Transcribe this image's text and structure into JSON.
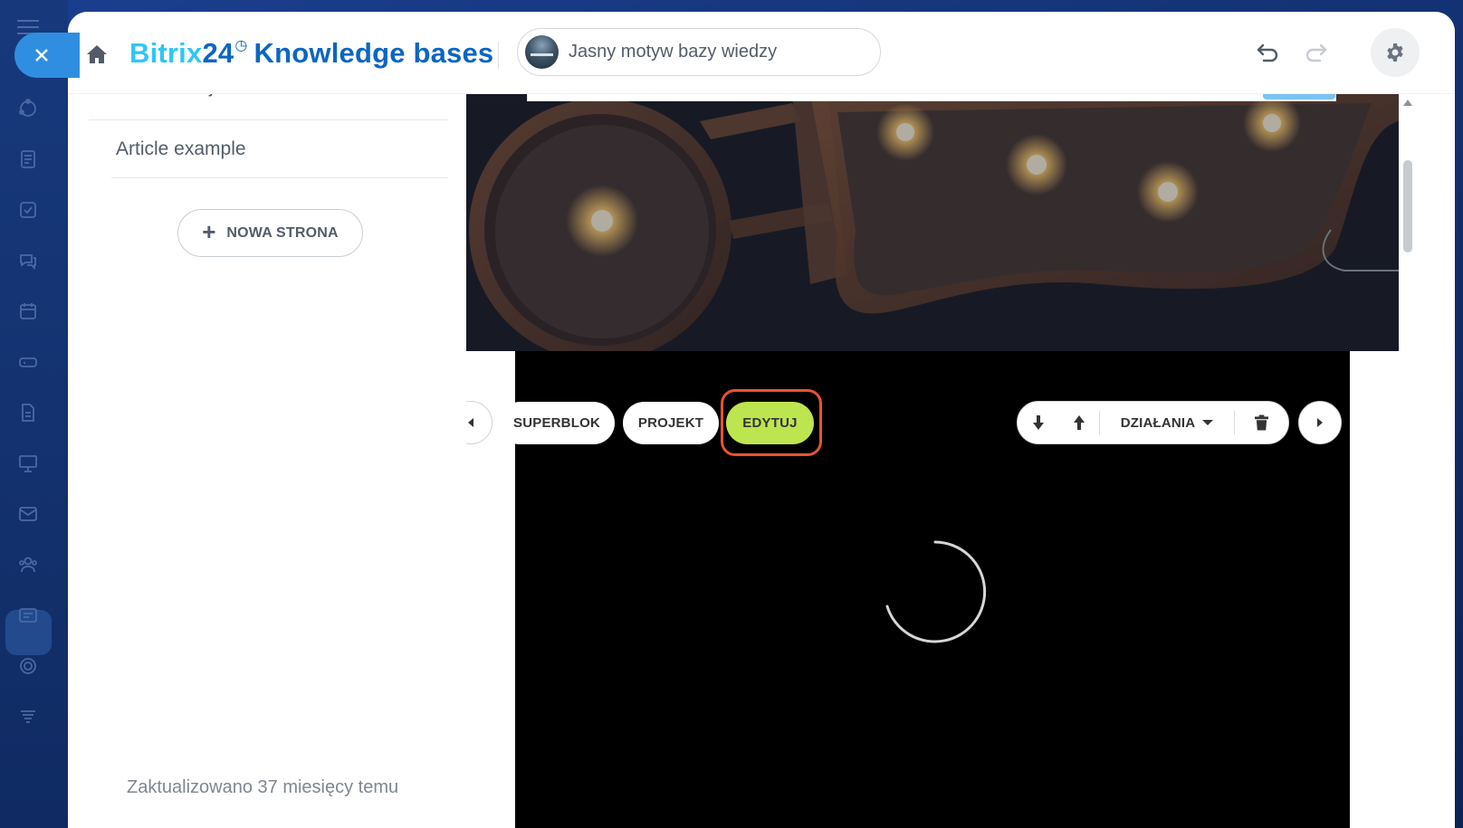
{
  "brand": {
    "part1": "Bitrix",
    "part2": "24",
    "clock_glyph": "◷",
    "title": "Knowledge bases"
  },
  "header": {
    "theme_label": "Jasny motyw bazy wiedzy"
  },
  "sidebar": {
    "items": [
      {
        "label": "Tasks and Projects"
      },
      {
        "label": "Article example"
      }
    ],
    "new_page_label": "NOWA STRONA",
    "updated_text": "Zaktualizowano 37 miesięcy temu"
  },
  "toolbar": {
    "superblock_label": "SUPERBLOK",
    "design_label": "PROJEKT",
    "edit_label": "EDYTUJ",
    "actions_label": "DZIAŁANIA"
  },
  "colors": {
    "accent_blue": "#2fc6f6",
    "brand_blue": "#0b66c3",
    "edit_green": "#bde550",
    "highlight": "#e8532f"
  },
  "icons": {
    "close": "close-icon",
    "home": "home-icon",
    "undo": "undo-icon",
    "redo": "redo-icon",
    "settings": "gear-icon",
    "move_down": "arrow-down-icon",
    "move_up": "arrow-up-icon",
    "delete": "trash-icon",
    "prev": "chevron-left-icon",
    "next": "chevron-right-icon",
    "loading": "spinner-icon"
  }
}
